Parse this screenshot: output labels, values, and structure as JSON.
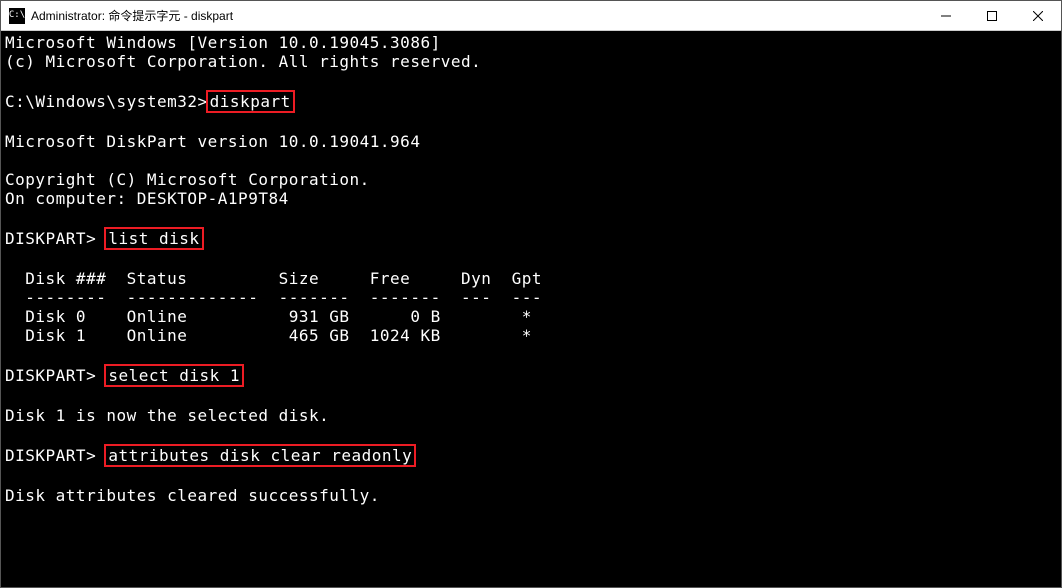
{
  "titlebar": {
    "icon_text": "C:\\",
    "title": "Administrator: 命令提示字元 - diskpart"
  },
  "terminal": {
    "line1": "Microsoft Windows [Version 10.0.19045.3086]",
    "line2": "(c) Microsoft Corporation. All rights reserved.",
    "path_prompt": "C:\\Windows\\system32>",
    "cmd_diskpart": "diskpart",
    "diskpart_version": "Microsoft DiskPart version 10.0.19041.964",
    "copyright": "Copyright (C) Microsoft Corporation.",
    "on_computer": "On computer: DESKTOP-A1P9T84",
    "dp_prompt1": "DISKPART> ",
    "cmd_list": "list disk",
    "table_header": "  Disk ###  Status         Size     Free     Dyn  Gpt",
    "table_divider": "  --------  -------------  -------  -------  ---  ---",
    "table_row0": "  Disk 0    Online          931 GB      0 B        *",
    "table_row1": "  Disk 1    Online          465 GB  1024 KB        *",
    "dp_prompt2": "DISKPART> ",
    "cmd_select": "select disk 1",
    "selected_msg": "Disk 1 is now the selected disk.",
    "dp_prompt3": "DISKPART> ",
    "cmd_attr": "attributes disk clear readonly",
    "cleared_msg": "Disk attributes cleared successfully."
  }
}
